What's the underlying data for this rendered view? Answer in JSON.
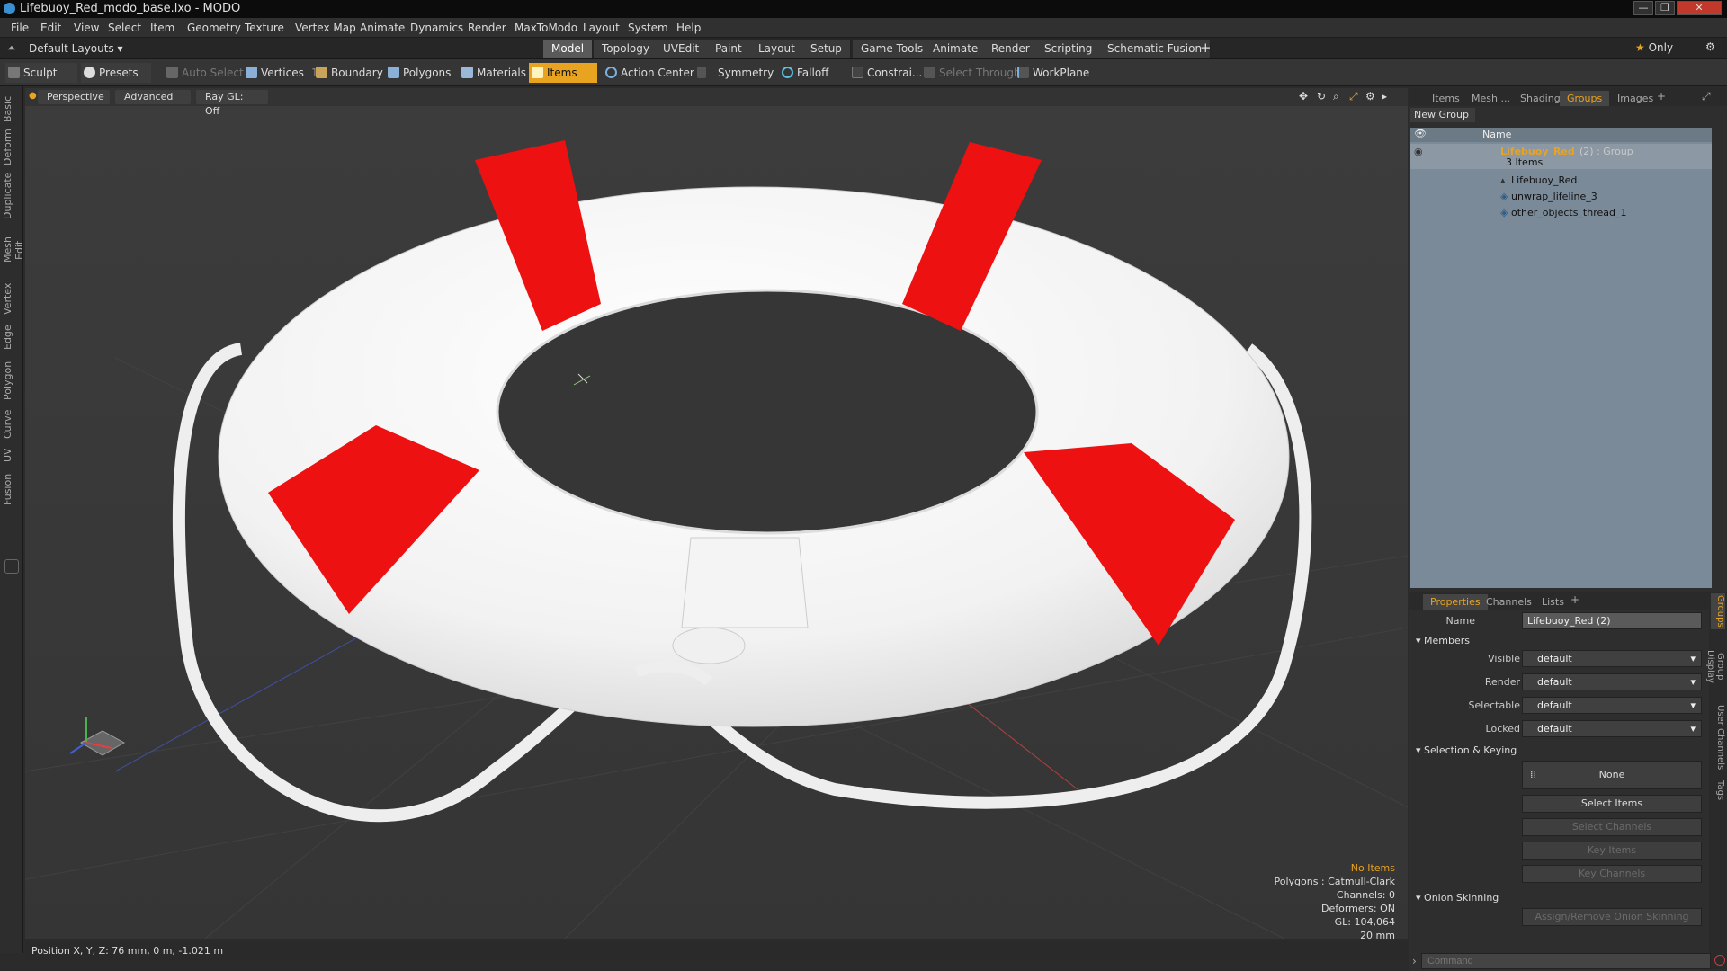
{
  "window": {
    "title": "Lifebuoy_Red_modo_base.lxo - MODO"
  },
  "menu": [
    "File",
    "Edit",
    "View",
    "Select",
    "Item",
    "Geometry",
    "Texture",
    "Vertex Map",
    "Animate",
    "Dynamics",
    "Render",
    "MaxToModo",
    "Layout",
    "System",
    "Help"
  ],
  "layouts": {
    "selector": "Default Layouts ▾",
    "tabs": [
      "Model",
      "Topology",
      "UVEdit",
      "Paint",
      "Layout",
      "Setup",
      "Game Tools",
      "Animate",
      "Render",
      "Scripting",
      "Schematic Fusion"
    ],
    "active": "Model",
    "only": "Only"
  },
  "toolbar": {
    "sculpt": "Sculpt",
    "presets": "Presets",
    "auto_select": "Auto Select",
    "vertices": "Vertices",
    "vertices_count": "1",
    "boundary": "Boundary",
    "polygons": "Polygons",
    "materials": "Materials",
    "items": "Items",
    "action_center": "Action Center",
    "symmetry": "Symmetry",
    "falloff": "Falloff",
    "constraints": "Constrai...",
    "select_through": "Select Through",
    "workplane": "WorkPlane"
  },
  "left_tabs": [
    "Basic",
    "Deform",
    "Duplicate",
    "Mesh Edit",
    "Vertex",
    "Edge",
    "Polygon",
    "Curve",
    "UV",
    "Fusion"
  ],
  "viewport": {
    "view": "Perspective",
    "shading": "Advanced",
    "raygl": "Ray GL: Off",
    "info": {
      "no_items": "No Items",
      "polygons": "Polygons : Catmull-Clark",
      "channels": "Channels: 0",
      "deformers": "Deformers: ON",
      "gl": "GL: 104,064",
      "scale": "20 mm"
    }
  },
  "status": {
    "position": "Position X, Y, Z:  76 mm, 0 m, -1.021 m"
  },
  "scene_panel": {
    "tabs": [
      "Items",
      "Mesh ...",
      "Shading",
      "Groups",
      "Images"
    ],
    "active_tab": "Groups",
    "new_group": "New Group",
    "col_name": "Name",
    "group": {
      "name": "Lifebuoy_Red",
      "suffix": "(2) : Group",
      "count": "3 Items"
    },
    "children": [
      "Lifebuoy_Red",
      "unwrap_lifeline_3",
      "other_objects_thread_1"
    ]
  },
  "props_panel": {
    "tabs": [
      "Properties",
      "Channels",
      "Lists"
    ],
    "active_tab": "Properties",
    "name_label": "Name",
    "name_value": "Lifebuoy_Red (2)",
    "members": "Members",
    "rows": [
      {
        "label": "Visible",
        "value": "default"
      },
      {
        "label": "Render",
        "value": "default"
      },
      {
        "label": "Selectable",
        "value": "default"
      },
      {
        "label": "Locked",
        "value": "default"
      }
    ],
    "selection_keying": "Selection & Keying",
    "none": "None",
    "select_items": "Select Items",
    "select_channels": "Select Channels",
    "key_items": "Key Items",
    "key_channels": "Key Channels",
    "onion": "Onion Skinning",
    "onion_btn": "Assign/Remove Onion Skinning",
    "side_tabs": [
      "Groups",
      "Group Display",
      "User Channels",
      "Tags"
    ]
  },
  "command": {
    "placeholder": "Command"
  },
  "colors": {
    "accent": "#e8a321",
    "lifebuoy_red": "#ee1111",
    "lifebuoy_white": "#ffffff",
    "grid_bg": "#3a3a3a"
  }
}
